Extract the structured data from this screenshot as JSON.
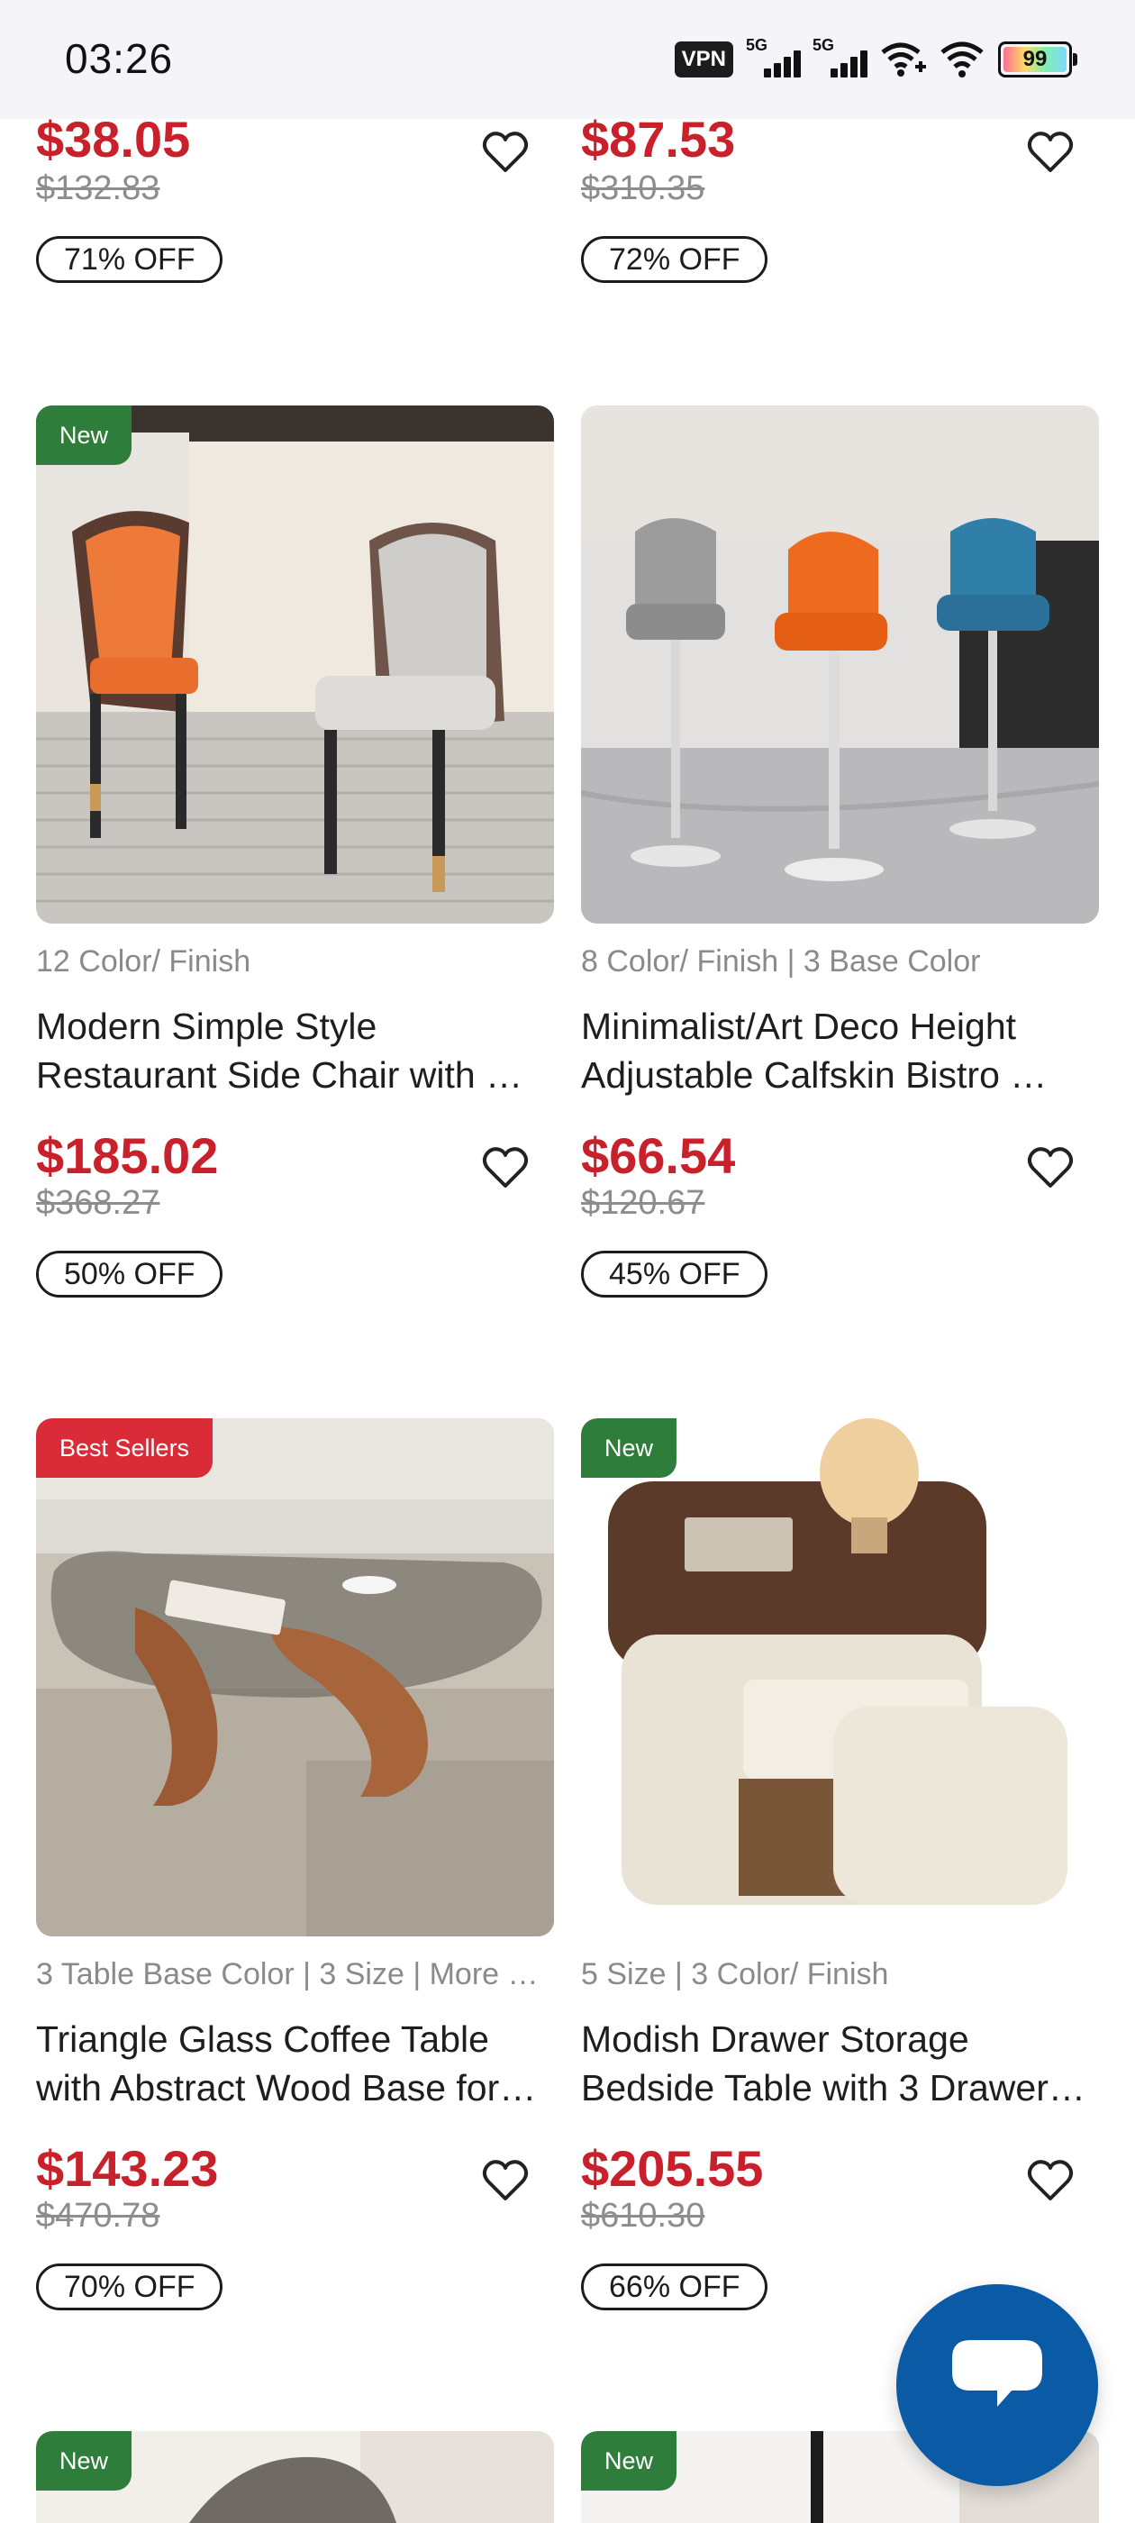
{
  "status_bar": {
    "time": "03:26",
    "vpn": "VPN",
    "net1": "5G",
    "net2": "5G",
    "battery": "99",
    "icons": [
      "vpn-icon",
      "signal-icon",
      "signal-icon",
      "wifi-plus-icon",
      "wifi-icon",
      "battery-icon"
    ]
  },
  "colors": {
    "price": "#c8212b",
    "new_tag": "#2e7d3a",
    "best_tag": "#d92b38",
    "chat": "#0b5aa6"
  },
  "products": [
    {
      "tag": "",
      "options": "",
      "title": "",
      "price": "$38.05",
      "old_price": "$132.83",
      "discount": "71% OFF"
    },
    {
      "tag": "",
      "options": "",
      "title": "",
      "price": "$87.53",
      "old_price": "$310.35",
      "discount": "72% OFF"
    },
    {
      "tag": "New",
      "options": "12 Color/ Finish",
      "title": "Modern Simple Style Restaurant Side Chair with …",
      "price": "$185.02",
      "old_price": "$368.27",
      "discount": "50% OFF"
    },
    {
      "tag": "",
      "options": "8 Color/ Finish | 3 Base Color",
      "title": "Minimalist/Art Deco Height Adjustable Calfskin Bistro …",
      "price": "$66.54",
      "old_price": "$120.67",
      "discount": "45% OFF"
    },
    {
      "tag": "Best Sellers",
      "options": "3 Table Base Color | 3 Size | More …",
      "title": "Triangle Glass Coffee Table with Abstract Wood Base for…",
      "price": "$143.23",
      "old_price": "$470.78",
      "discount": "70% OFF"
    },
    {
      "tag": "New",
      "options": "5 Size | 3 Color/ Finish",
      "title": "Modish Drawer Storage Bedside Table with 3 Drawer…",
      "price": "$205.55",
      "old_price": "$610.30",
      "discount": "66% OFF"
    },
    {
      "tag": "New"
    },
    {
      "tag": "New"
    }
  ]
}
